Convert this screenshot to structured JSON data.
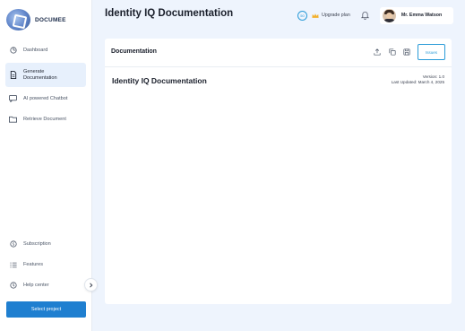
{
  "app": {
    "logo_text": "DOCUMEE"
  },
  "sidebar": {
    "items": [
      {
        "label": "Dashboard",
        "icon": "dashboard-icon"
      },
      {
        "label": "Generate Documentation",
        "icon": "document-icon",
        "active": true
      },
      {
        "label": "AI powered Chatbot",
        "icon": "chat-icon"
      },
      {
        "label": "Retrieve Document",
        "icon": "folder-icon"
      }
    ],
    "bottom_items": [
      {
        "label": "Subscription",
        "icon": "dollar-icon"
      },
      {
        "label": "Features",
        "icon": "list-icon"
      },
      {
        "label": "Help center",
        "icon": "help-icon"
      }
    ],
    "select_project_label": "Select project"
  },
  "header": {
    "title": "Identity IQ Documentation",
    "credits": "50",
    "upgrade_label": "Upgrade plan",
    "user_name": "Mr. Emma Watson"
  },
  "card": {
    "title": "Documentation",
    "issues_label": "Issues",
    "doc_title": "Identity IQ Documentation",
    "version": "Version: 1.0",
    "last_updated": "Last Updated: March 4, 2025"
  },
  "colors": {
    "accent": "#1f7fd0",
    "accent_light": "#2a9bd8",
    "background": "#eef4fd",
    "active_nav": "#e7f0fc"
  }
}
